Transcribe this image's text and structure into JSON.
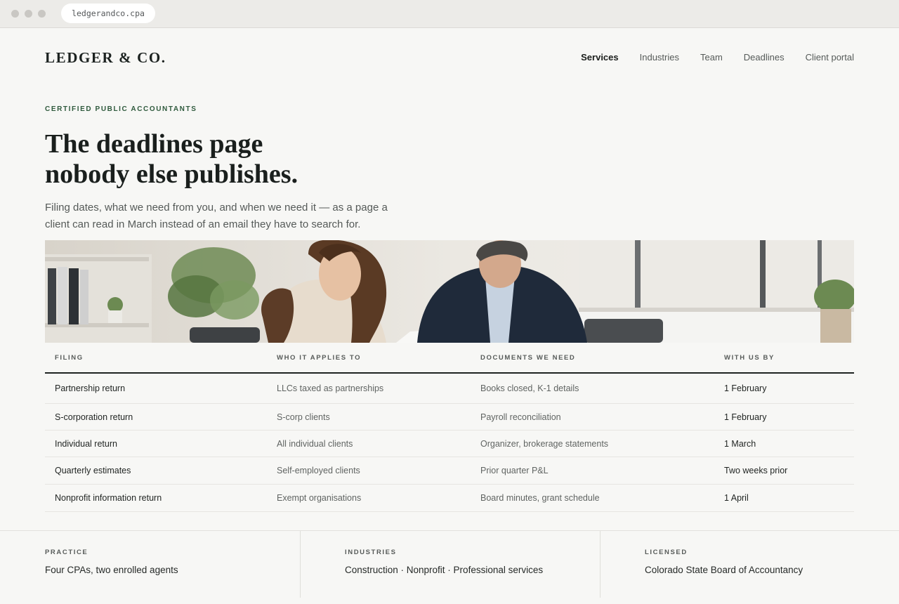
{
  "browser": {
    "url": "ledgerandco.cpa"
  },
  "header": {
    "logo": "LEDGER & CO.",
    "nav": [
      {
        "label": "Services",
        "active": true
      },
      {
        "label": "Industries",
        "active": false
      },
      {
        "label": "Team",
        "active": false
      },
      {
        "label": "Deadlines",
        "active": false
      },
      {
        "label": "Client portal",
        "active": false
      }
    ]
  },
  "hero": {
    "eyebrow": "CERTIFIED PUBLIC ACCOUNTANTS",
    "headline_line1": "The deadlines page",
    "headline_line2": "nobody else publishes.",
    "lede": "Filing dates, what we need from you, and when we need it — as a page a client can read in March instead of an email they have to search for."
  },
  "table": {
    "headers": [
      "FILING",
      "WHO IT APPLIES TO",
      "DOCUMENTS WE NEED",
      "WITH US BY"
    ],
    "rows": [
      [
        "Partnership return",
        "LLCs taxed as partnerships",
        "Books closed, K-1 details",
        "1 February"
      ],
      [
        "S-corporation return",
        "S-corp clients",
        "Payroll reconciliation",
        "1 February"
      ],
      [
        "Individual return",
        "All individual clients",
        "Organizer, brokerage statements",
        "1 March"
      ],
      [
        "Quarterly estimates",
        "Self-employed clients",
        "Prior quarter P&L",
        "Two weeks prior"
      ],
      [
        "Nonprofit information return",
        "Exempt organisations",
        "Board minutes, grant schedule",
        "1 April"
      ]
    ]
  },
  "footer": [
    {
      "label": "PRACTICE",
      "value": "Four CPAs, two enrolled agents"
    },
    {
      "label": "INDUSTRIES",
      "value": "Construction · Nonprofit · Professional services"
    },
    {
      "label": "LICENSED",
      "value": "Colorado State Board of Accountancy"
    }
  ]
}
